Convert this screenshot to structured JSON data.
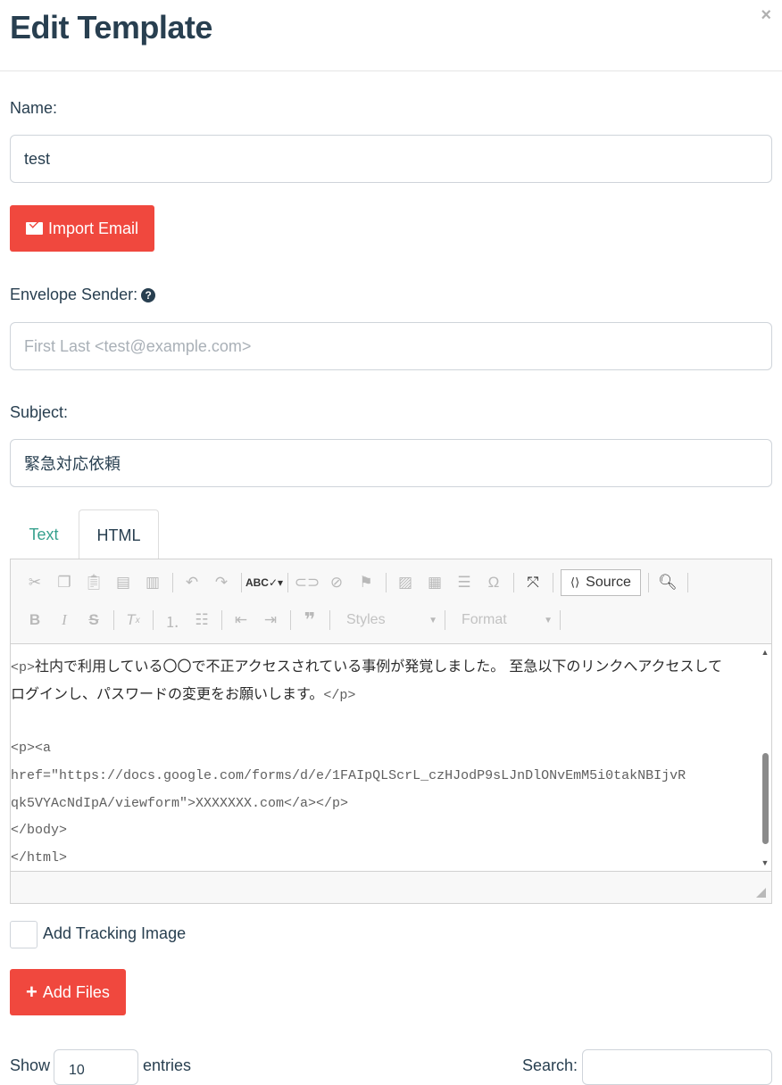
{
  "modal": {
    "title": "Edit Template",
    "close": "×"
  },
  "form": {
    "name_label": "Name:",
    "name_value": "test",
    "import_button": "Import Email",
    "envelope_label": "Envelope Sender:",
    "envelope_placeholder": "First Last <test@example.com>",
    "subject_label": "Subject:",
    "subject_value": "緊急対応依頼"
  },
  "tabs": [
    {
      "label": "Text",
      "active": false
    },
    {
      "label": "HTML",
      "active": true
    }
  ],
  "editor": {
    "source_button": "Source",
    "styles_combo": "Styles",
    "format_combo": "Format",
    "code": {
      "p_open": "<p>",
      "jp_line1": "社内で利用している〇〇で不正アクセスされている事例が発覚しました。 至急以下のリンクへアクセスして",
      "jp_line2": "ログインし、パスワードの変更をお願いします。",
      "p_close": "</p>",
      "link_open": "<p><a",
      "href_line1": "href=\"https://docs.google.com/forms/d/e/1FAIpQLScrL_czHJodP9sLJnDlONvEmM5i0takNBIjvR",
      "href_line2": "qk5VYAcNdIpA/viewform\">XXXXXXX.com</a></p>",
      "body_close": "</body>",
      "html_close": "</html>"
    }
  },
  "tracking": {
    "label": "Add Tracking Image",
    "checked": false
  },
  "attachments": {
    "button": "Add Files"
  },
  "table_controls": {
    "show_label": "Show",
    "entries_label": "entries",
    "page_size": "10",
    "search_label": "Search:"
  },
  "icons": {
    "import": "envelope-icon",
    "help": "question-circle-icon",
    "add_files": "plus-icon",
    "close": "close-icon"
  },
  "colors": {
    "primary_text": "#283f50",
    "danger": "#f0483e",
    "tab_link": "#37a18e"
  }
}
